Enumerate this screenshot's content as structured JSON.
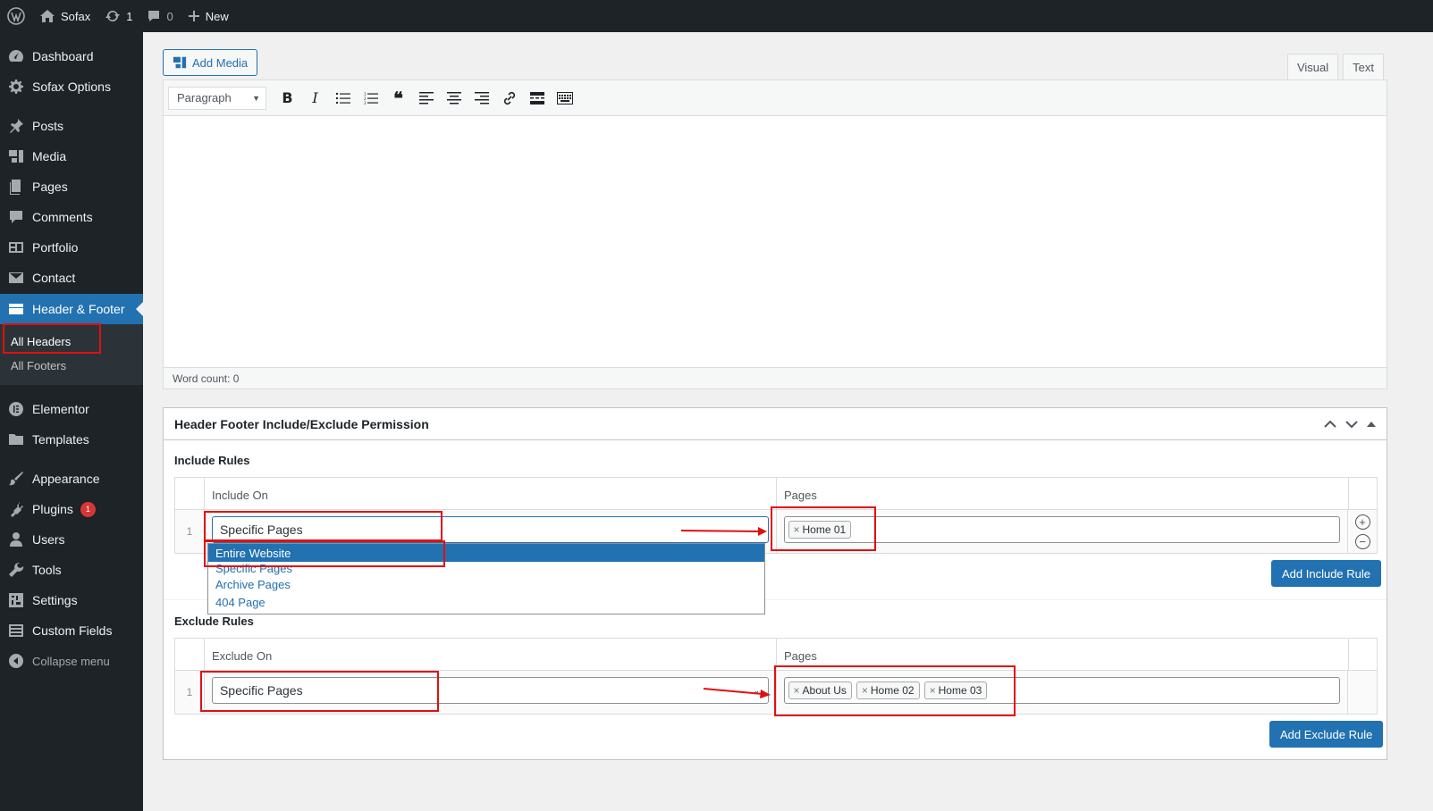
{
  "adminbar": {
    "site_name": "Sofax",
    "updates_count": "1",
    "comments_count": "0",
    "new_label": "New"
  },
  "sidebar": {
    "items": [
      {
        "label": "Dashboard",
        "icon": "dashboard-icon"
      },
      {
        "label": "Sofax Options",
        "icon": "gear-icon"
      },
      {
        "label": "Posts",
        "icon": "pin-icon"
      },
      {
        "label": "Media",
        "icon": "media-icon"
      },
      {
        "label": "Pages",
        "icon": "pages-icon"
      },
      {
        "label": "Comments",
        "icon": "comment-icon"
      },
      {
        "label": "Portfolio",
        "icon": "portfolio-icon"
      },
      {
        "label": "Contact",
        "icon": "mail-icon"
      },
      {
        "label": "Header & Footer",
        "icon": "header-footer-icon"
      },
      {
        "label": "Elementor",
        "icon": "elementor-icon"
      },
      {
        "label": "Templates",
        "icon": "folder-icon"
      },
      {
        "label": "Appearance",
        "icon": "brush-icon"
      },
      {
        "label": "Plugins",
        "icon": "plugin-icon",
        "badge": "1"
      },
      {
        "label": "Users",
        "icon": "user-icon"
      },
      {
        "label": "Tools",
        "icon": "wrench-icon"
      },
      {
        "label": "Settings",
        "icon": "settings-icon"
      },
      {
        "label": "Custom Fields",
        "icon": "fields-icon"
      }
    ],
    "submenu": [
      "All Headers",
      "All Footers"
    ],
    "collapse_label": "Collapse menu"
  },
  "editor": {
    "add_media_label": "Add Media",
    "tabs": [
      "Visual",
      "Text"
    ],
    "format_select": "Paragraph",
    "word_count": "Word count: 0"
  },
  "metabox": {
    "title": "Header Footer Include/Exclude Permission",
    "include": {
      "section_title": "Include Rules",
      "col_on": "Include On",
      "col_pages": "Pages",
      "row_num": "1",
      "selected": "Specific Pages",
      "tags": [
        "Home 01"
      ],
      "button": "Add Include Rule"
    },
    "exclude": {
      "section_title": "Exclude Rules",
      "col_on": "Exclude On",
      "col_pages": "Pages",
      "row_num": "1",
      "selected": "Specific Pages",
      "tags": [
        "About Us",
        "Home 02",
        "Home 03"
      ],
      "button": "Add Exclude Rule"
    },
    "dropdown_options": [
      "Entire Website",
      "Specific Pages",
      "Archive Pages",
      "404 Page"
    ]
  },
  "colors": {
    "accent": "#2271b1",
    "sidebar_bg": "#1d2327",
    "annotation": "#e01010"
  }
}
